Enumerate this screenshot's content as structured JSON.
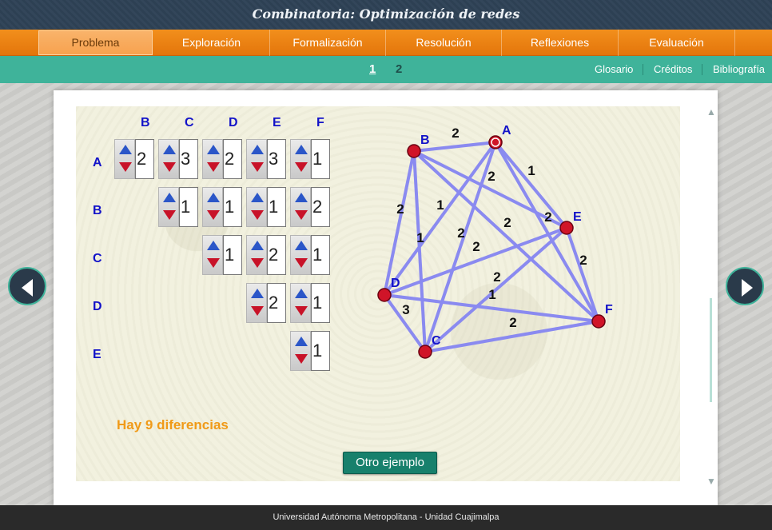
{
  "header": {
    "title": "Combinatoria: Optimización de redes"
  },
  "nav": {
    "items": [
      {
        "label": "Problema",
        "active": true
      },
      {
        "label": "Exploración"
      },
      {
        "label": "Formalización"
      },
      {
        "label": "Resolución"
      },
      {
        "label": "Reflexiones"
      },
      {
        "label": "Evaluación"
      }
    ]
  },
  "subnav": {
    "pages": [
      "1",
      "2"
    ],
    "current_page": "1",
    "links": [
      "Glosario",
      "Créditos",
      "Bibliografía"
    ]
  },
  "matrix": {
    "col_headers": [
      "B",
      "C",
      "D",
      "E",
      "F"
    ],
    "row_headers": [
      "A",
      "B",
      "C",
      "D",
      "E"
    ],
    "cells": {
      "A_B": "2",
      "A_C": "3",
      "A_D": "2",
      "A_E": "3",
      "A_F": "1",
      "B_C": "1",
      "B_D": "1",
      "B_E": "1",
      "B_F": "2",
      "C_D": "1",
      "C_E": "2",
      "C_F": "1",
      "D_E": "2",
      "D_F": "1",
      "E_F": "1"
    }
  },
  "graph": {
    "nodes": [
      {
        "id": "A",
        "label": "A"
      },
      {
        "id": "B",
        "label": "B"
      },
      {
        "id": "C",
        "label": "C"
      },
      {
        "id": "D",
        "label": "D"
      },
      {
        "id": "E",
        "label": "E"
      },
      {
        "id": "F",
        "label": "F"
      }
    ],
    "edges": [
      {
        "from": "A",
        "to": "B",
        "weight": "2"
      },
      {
        "from": "A",
        "to": "C",
        "weight": "2"
      },
      {
        "from": "A",
        "to": "D",
        "weight": "1"
      },
      {
        "from": "A",
        "to": "F",
        "weight": "1"
      },
      {
        "from": "B",
        "to": "C",
        "weight": "1"
      },
      {
        "from": "B",
        "to": "D",
        "weight": "2"
      },
      {
        "from": "B",
        "to": "E",
        "weight": "2"
      },
      {
        "from": "B",
        "to": "F",
        "weight": "2"
      },
      {
        "from": "C",
        "to": "D",
        "weight": "3"
      },
      {
        "from": "C",
        "to": "E",
        "weight": "1"
      },
      {
        "from": "C",
        "to": "F",
        "weight": "2"
      },
      {
        "from": "D",
        "to": "E",
        "weight": "2"
      },
      {
        "from": "D",
        "to": "F",
        "weight": "2"
      },
      {
        "from": "E",
        "to": "F",
        "weight": "2"
      },
      {
        "from": "A",
        "to": "E",
        "weight": "2"
      }
    ],
    "edge_color": "#8a8af0",
    "node_color": "#d01428",
    "label_color": "#1212c8"
  },
  "message": "Hay 9 diferencias",
  "button_otro": "Otro ejemplo",
  "footer": "Universidad Autónoma Metropolitana - Unidad Cuajimalpa",
  "icons": {
    "prev": "chevron-left-icon",
    "next": "chevron-right-icon",
    "scroll_up": "scroll-up-icon",
    "scroll_down": "scroll-down-icon"
  }
}
